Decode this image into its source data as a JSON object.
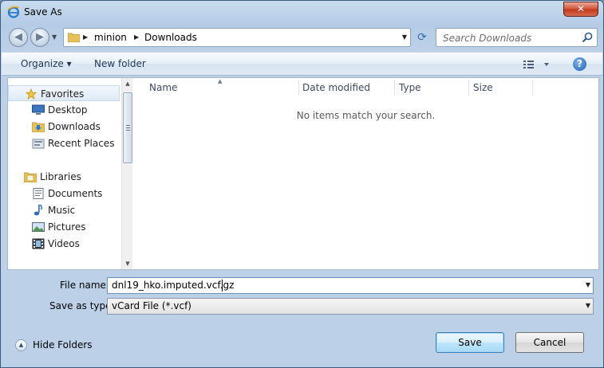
{
  "window": {
    "title": "Save As",
    "close_label": "✕"
  },
  "navigation": {
    "breadcrumb": [
      "minion",
      "Downloads"
    ],
    "search_placeholder": "Search Downloads"
  },
  "toolbar": {
    "organize_label": "Organize ▾",
    "new_folder_label": "New folder",
    "help_label": "?"
  },
  "sidebar": {
    "favorites_label": "Favorites",
    "favorites": [
      "Desktop",
      "Downloads",
      "Recent Places"
    ],
    "libraries_label": "Libraries",
    "libraries": [
      "Documents",
      "Music",
      "Pictures",
      "Videos"
    ]
  },
  "file_list": {
    "columns": [
      "Name",
      "Date modified",
      "Type",
      "Size"
    ],
    "empty_message": "No items match your search."
  },
  "form": {
    "file_name_label": "File name:",
    "file_name_value": "dnl19_hko.imputed.vcf.gz",
    "save_type_label": "Save as type:",
    "save_type_value": "vCard File (*.vcf)"
  },
  "footer": {
    "hide_folders_label": "Hide Folders",
    "save_label": "Save",
    "cancel_label": "Cancel"
  },
  "colors": {
    "window_frame": "#b9cfe8",
    "selection": "#dfeaf7",
    "save_button": "#bee6fd"
  }
}
